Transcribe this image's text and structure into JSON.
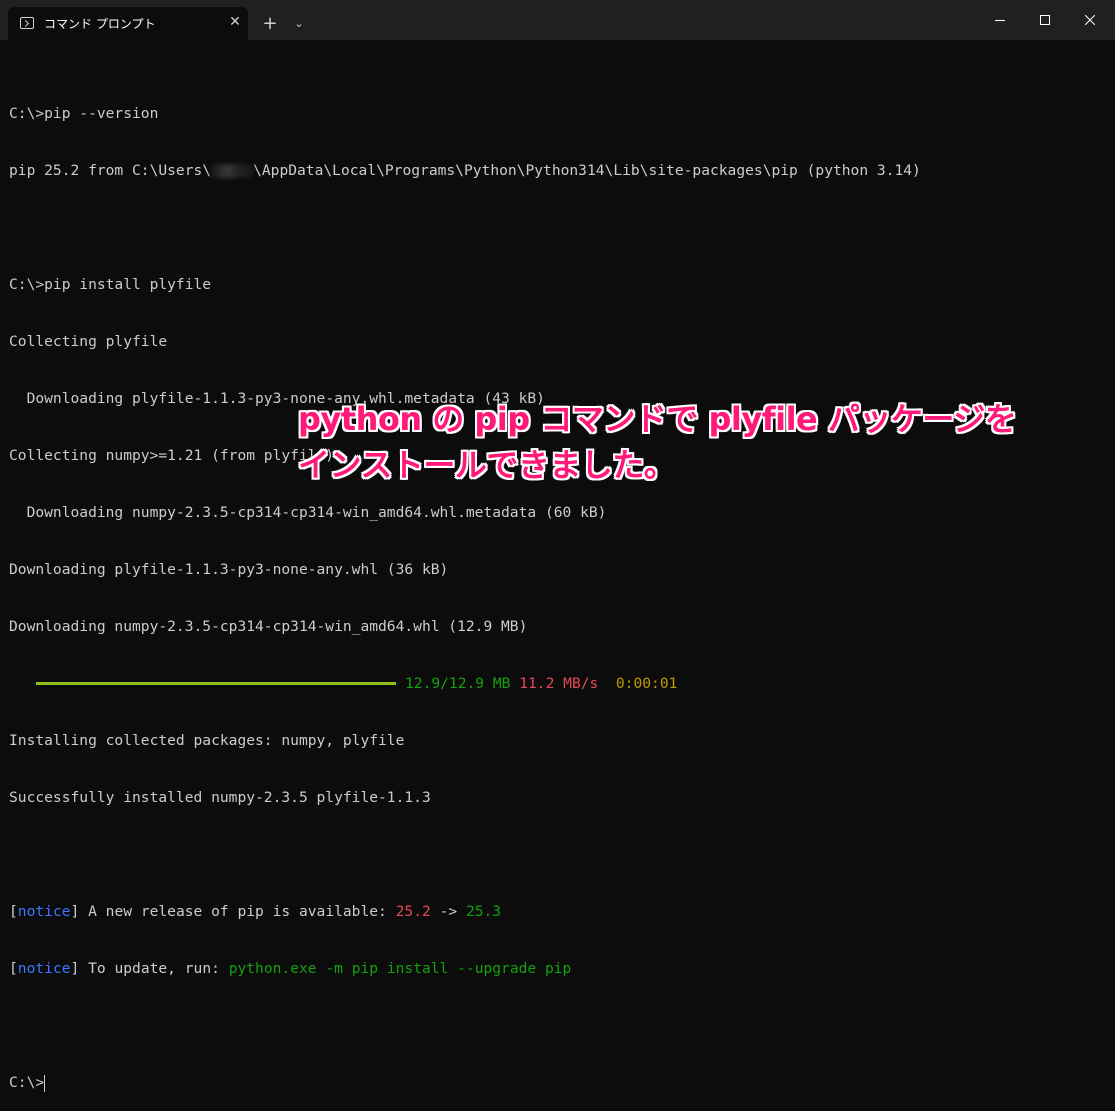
{
  "window": {
    "tab_title": "コマンド プロンプト",
    "tab_close": "✕",
    "new_tab": "+",
    "dropdown": "⌄"
  },
  "colors": {
    "background": "#0c0c0c",
    "titlebar": "#202020",
    "text": "#cccccc",
    "green": "#13a10e",
    "red": "#e74856",
    "yellow": "#c19c00",
    "blue": "#3b78ff",
    "annotation": "#ff1a7a"
  },
  "terminal": {
    "l1": "C:\\>pip --version",
    "l2a": "pip 25.2 from C:\\Users\\",
    "l2b": "\\AppData\\Local\\Programs\\Python\\Python314\\Lib\\site-packages\\pip (python 3.14)",
    "l3": "C:\\>pip install plyfile",
    "l4": "Collecting plyfile",
    "l5": "  Downloading plyfile-1.1.3-py3-none-any.whl.metadata (43 kB)",
    "l6": "Collecting numpy>=1.21 (from plyfile)",
    "l7": "  Downloading numpy-2.3.5-cp314-cp314-win_amd64.whl.metadata (60 kB)",
    "l8": "Downloading plyfile-1.1.3-py3-none-any.whl (36 kB)",
    "l9": "Downloading numpy-2.3.5-cp314-cp314-win_amd64.whl (12.9 MB)",
    "progress": {
      "fraction": 1.0,
      "size": "12.9/12.9 MB",
      "speed": "11.2 MB/s",
      "eta": "0:00:01"
    },
    "l11": "Installing collected packages: numpy, plyfile",
    "l12": "Successfully installed numpy-2.3.5 plyfile-1.1.3",
    "notice_tag": "notice",
    "notice1_text": " A new release of pip is available: ",
    "notice1_old": "25.2",
    "notice1_arrow": " -> ",
    "notice1_new": "25.3",
    "notice2_text": " To update, run: ",
    "notice2_cmd": "python.exe -m pip install --upgrade pip",
    "prompt": "C:\\>"
  },
  "annotation": {
    "line1": "python の pip コマンドで plyfile パッケージを",
    "line2": "インストールできました。"
  }
}
